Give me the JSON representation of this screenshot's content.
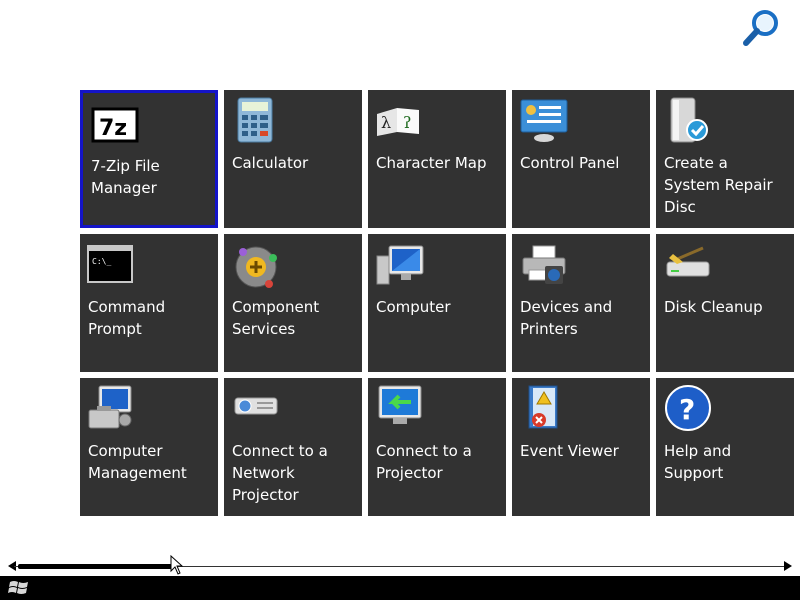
{
  "search": {
    "icon": "magnifier-icon"
  },
  "apps": [
    {
      "label": "7-Zip File Manager",
      "icon": "7zip-icon",
      "selected": true
    },
    {
      "label": "Calculator",
      "icon": "calculator-icon"
    },
    {
      "label": "Character Map",
      "icon": "character-map-icon"
    },
    {
      "label": "Control Panel",
      "icon": "control-panel-icon"
    },
    {
      "label": "Create a System Repair Disc",
      "icon": "repair-disc-icon"
    },
    {
      "label": "Command Prompt",
      "icon": "command-prompt-icon"
    },
    {
      "label": "Component Services",
      "icon": "component-services-icon"
    },
    {
      "label": "Computer",
      "icon": "computer-icon"
    },
    {
      "label": "Devices and Printers",
      "icon": "printer-icon"
    },
    {
      "label": "Disk Cleanup",
      "icon": "disk-cleanup-icon"
    },
    {
      "label": "Computer Management",
      "icon": "computer-management-icon"
    },
    {
      "label": "Connect to a Network Projector",
      "icon": "network-projector-icon"
    },
    {
      "label": "Connect to a Projector",
      "icon": "projector-display-icon"
    },
    {
      "label": "Event Viewer",
      "icon": "event-viewer-icon"
    },
    {
      "label": "Help and Support",
      "icon": "help-icon"
    }
  ],
  "colors": {
    "tile": "#323232",
    "selected_border": "#1414c8",
    "taskbar": "#000000",
    "background": "#ffffff"
  },
  "scrollbar": {
    "position": 0
  },
  "taskbar": {
    "start_icon": "windows-logo-icon"
  }
}
